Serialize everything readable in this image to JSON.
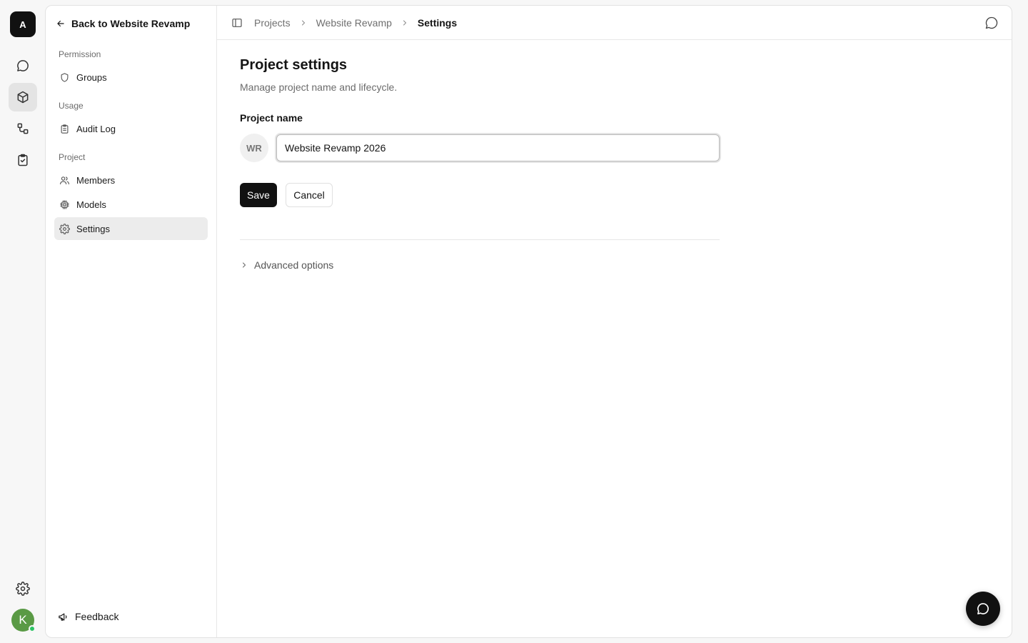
{
  "workspace": {
    "initial": "A"
  },
  "user": {
    "initial": "K"
  },
  "sidebar": {
    "back_label": "Back to Website Revamp",
    "sections": [
      {
        "label": "Permission",
        "items": [
          {
            "label": "Groups",
            "icon": "shield-icon"
          }
        ]
      },
      {
        "label": "Usage",
        "items": [
          {
            "label": "Audit Log",
            "icon": "clipboard-icon"
          }
        ]
      },
      {
        "label": "Project",
        "items": [
          {
            "label": "Members",
            "icon": "users-icon"
          },
          {
            "label": "Models",
            "icon": "chip-icon"
          },
          {
            "label": "Settings",
            "icon": "gear-icon",
            "active": true
          }
        ]
      }
    ],
    "feedback_label": "Feedback"
  },
  "breadcrumb": [
    "Projects",
    "Website Revamp",
    "Settings"
  ],
  "main": {
    "title": "Project settings",
    "subtitle": "Manage project name and lifecycle.",
    "project_name_label": "Project name",
    "project_initials": "WR",
    "project_name_value": "Website Revamp 2026",
    "save_label": "Save",
    "cancel_label": "Cancel",
    "advanced_label": "Advanced options"
  },
  "colors": {
    "primary": "#111111",
    "active_nav": "#ececec",
    "user_avatar": "#5a9a45",
    "online": "#2bc464"
  }
}
